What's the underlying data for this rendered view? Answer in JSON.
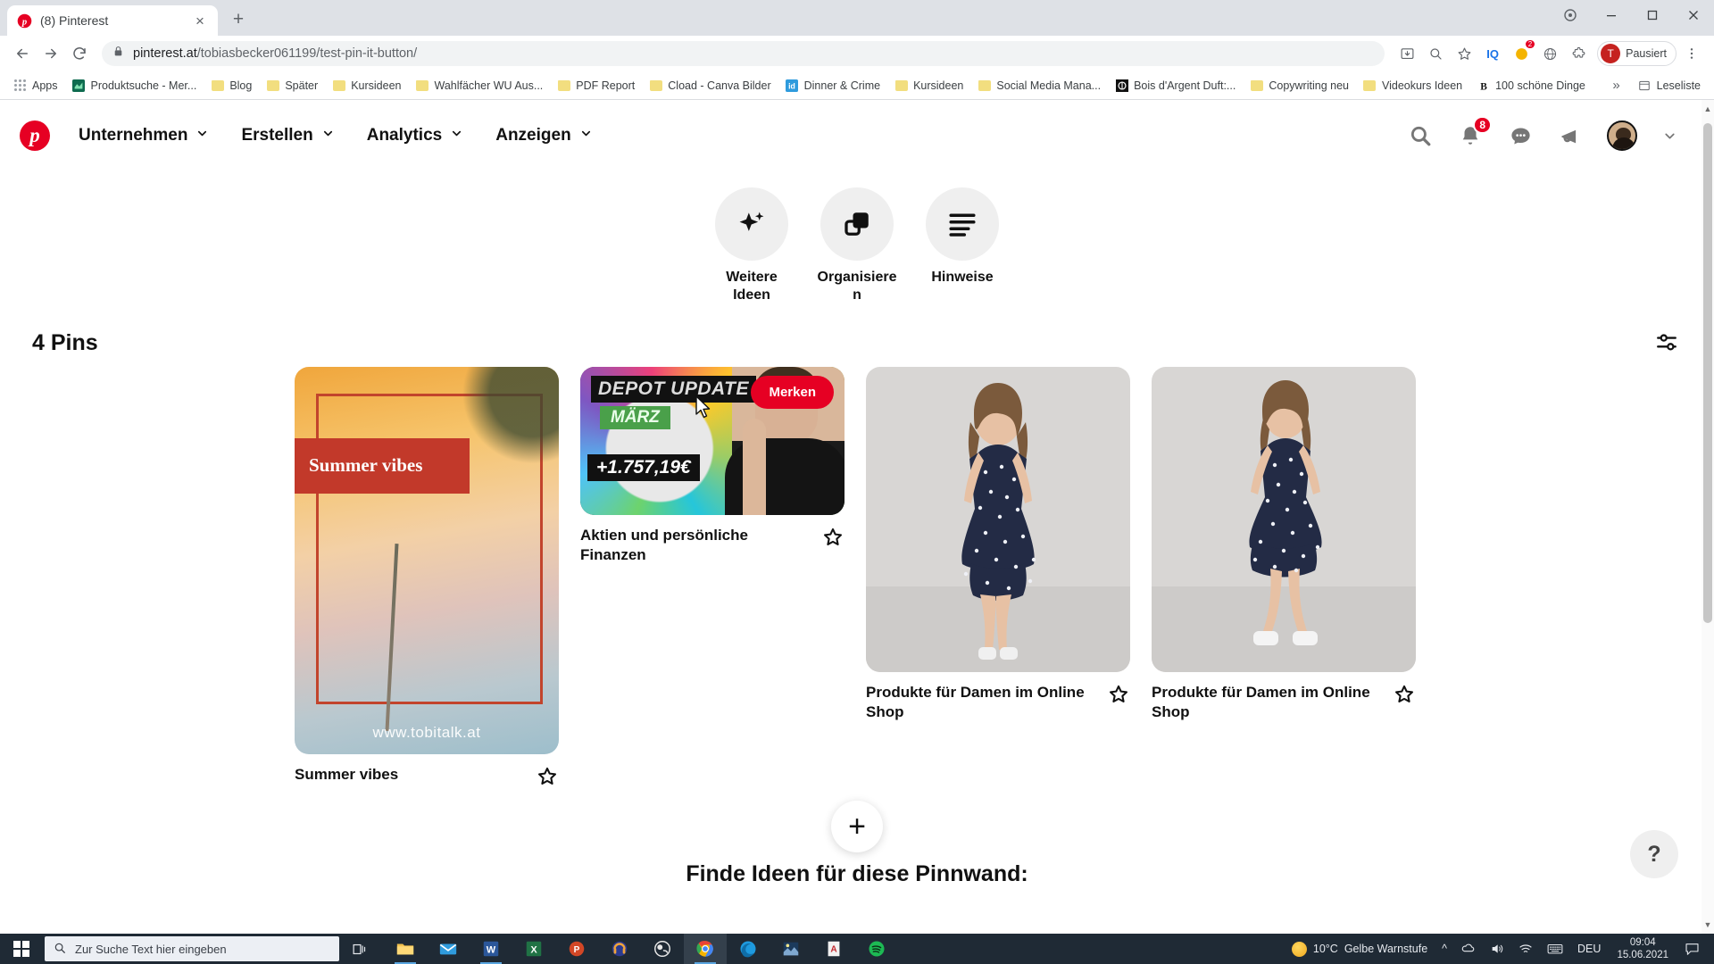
{
  "browser": {
    "tab": {
      "title": "(8) Pinterest",
      "favicon": "pinterest-icon",
      "close": "×"
    },
    "newtab_label": "+",
    "window_controls": {
      "minimize": "—",
      "maximize": "▢",
      "close": "✕"
    },
    "nav": {
      "back": "←",
      "forward": "→",
      "reload": "⟳"
    },
    "omnibox": {
      "lock_icon": "lock-icon",
      "url_host": "pinterest.at",
      "url_path": "/tobiasbecker061199/test-pin-it-button/"
    },
    "toolbar_right": {
      "install_icon": "install-app-icon",
      "zoom_icon": "zoom-search-icon",
      "bookmark_icon": "star-icon",
      "ext_iq": "IQ",
      "ext_badge": "2",
      "ext_globe": "globe-icon",
      "ext_puzzle": "extensions-icon",
      "profile_initial": "T",
      "profile_label": "Pausiert",
      "menu_icon": "three-dots-icon"
    },
    "bookmarks": [
      {
        "label": "Apps",
        "icon": "apps-grid-icon"
      },
      {
        "label": "Produktsuche - Mer...",
        "icon": "site-icon"
      },
      {
        "label": "Blog",
        "icon": "folder-icon"
      },
      {
        "label": "Später",
        "icon": "folder-icon"
      },
      {
        "label": "Kursideen",
        "icon": "folder-icon"
      },
      {
        "label": "Wahlfächer WU Aus...",
        "icon": "folder-icon"
      },
      {
        "label": "PDF Report",
        "icon": "folder-icon"
      },
      {
        "label": "Cload - Canva Bilder",
        "icon": "folder-icon"
      },
      {
        "label": "Dinner & Crime",
        "icon": "id-icon"
      },
      {
        "label": "Kursideen",
        "icon": "folder-icon"
      },
      {
        "label": "Social Media Mana...",
        "icon": "folder-icon"
      },
      {
        "label": "Bois d'Argent Duft:...",
        "icon": "dark-circle-icon"
      },
      {
        "label": "Copywriting neu",
        "icon": "folder-icon"
      },
      {
        "label": "Videokurs Ideen",
        "icon": "folder-icon"
      },
      {
        "label": "100 schöne Dinge",
        "icon": "b-icon"
      }
    ],
    "bookmarks_overflow": "»",
    "reading_list": {
      "label": "Leseliste",
      "icon": "reading-list-icon"
    }
  },
  "pinterest": {
    "logo": "p",
    "nav_items": [
      {
        "label": "Unternehmen",
        "chevron": "⌄"
      },
      {
        "label": "Erstellen",
        "chevron": "⌄"
      },
      {
        "label": "Analytics",
        "chevron": "⌄"
      },
      {
        "label": "Anzeigen",
        "chevron": "⌄"
      }
    ],
    "nav_right": {
      "search_icon": "search-icon",
      "bell_icon": "bell-icon",
      "bell_badge": "8",
      "messages_icon": "message-bubble-icon",
      "ads_icon": "megaphone-icon",
      "avatar": "user-avatar",
      "chevron": "⌄"
    },
    "actions": [
      {
        "label": "Weitere Ideen",
        "icon": "sparkle-icon"
      },
      {
        "label": "Organisieren",
        "icon": "organize-squares-icon"
      },
      {
        "label": "Hinweise",
        "icon": "notes-lines-icon"
      }
    ],
    "pins_header": {
      "count_label": "4 Pins",
      "filter_icon": "filter-sliders-icon"
    },
    "pins": [
      {
        "title": "Summer vibes",
        "art": {
          "headline": "Summer vibes",
          "url": "www.tobitalk.at"
        },
        "star_icon": "star-outline-icon"
      },
      {
        "title": "Aktien und persönliche Finanzen",
        "art": {
          "label_top": "DEPOT UPDATE",
          "label_mid": "MÄRZ",
          "label_amount": "+1.757,19€"
        },
        "save_button": "Merken",
        "star_icon": "star-outline-icon"
      },
      {
        "title": "Produkte für Damen im Online Shop",
        "star_icon": "star-outline-icon"
      },
      {
        "title": "Produkte für Damen im Online Shop",
        "star_icon": "star-outline-icon"
      }
    ],
    "add_button": "+",
    "find_ideas_title": "Finde Ideen für diese Pinnwand:",
    "help_button": "?"
  },
  "taskbar": {
    "start_icon": "windows-start-icon",
    "search_placeholder": "Zur Suche Text hier eingeben",
    "search_icon": "search-icon",
    "task_view_icon": "task-view-icon",
    "apps": [
      {
        "name": "file-explorer-icon"
      },
      {
        "name": "mail-icon"
      },
      {
        "name": "word-icon"
      },
      {
        "name": "excel-icon"
      },
      {
        "name": "powerpoint-icon"
      },
      {
        "name": "audacity-icon"
      },
      {
        "name": "obs-icon"
      },
      {
        "name": "chrome-icon"
      },
      {
        "name": "edge-icon"
      },
      {
        "name": "photos-icon"
      },
      {
        "name": "acrobat-icon"
      },
      {
        "name": "spotify-icon"
      }
    ],
    "weather": {
      "temp": "10°C",
      "condition": "Gelbe Warnstufe",
      "icon": "sun-icon"
    },
    "tray": {
      "chevron": "^",
      "onedrive_icon": "onedrive-icon",
      "volume_icon": "volume-icon",
      "wifi_icon": "wifi-icon",
      "keyboard_icon": "keyboard-icon",
      "language": "DEU"
    },
    "clock": {
      "time": "09:04",
      "date": "15.06.2021"
    },
    "notification_icon": "notification-icon"
  },
  "colors": {
    "pinterest_red": "#e60023",
    "chrome_bg": "#dee1e6",
    "taskbar_bg": "#1f2a35"
  }
}
